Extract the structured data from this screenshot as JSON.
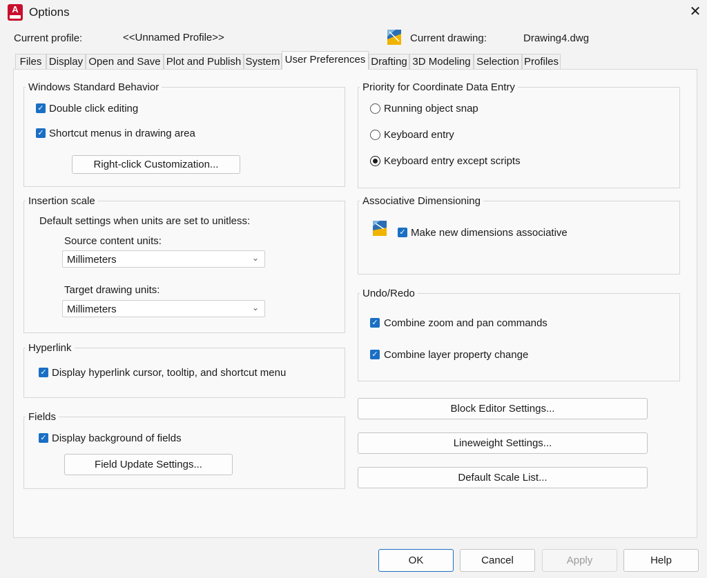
{
  "window": {
    "title": "Options",
    "app_icon_letter": "A",
    "close_icon": "close-icon"
  },
  "profile": {
    "label": "Current profile:",
    "value": "<<Unnamed Profile>>",
    "drawing_label": "Current drawing:",
    "drawing_value": "Drawing4.dwg",
    "drawing_icon": "drawing-icon"
  },
  "tabs": [
    {
      "label": "Files"
    },
    {
      "label": "Display"
    },
    {
      "label": "Open and Save"
    },
    {
      "label": "Plot and Publish"
    },
    {
      "label": "System"
    },
    {
      "label": "User Preferences",
      "active": true
    },
    {
      "label": "Drafting"
    },
    {
      "label": "3D Modeling"
    },
    {
      "label": "Selection"
    },
    {
      "label": "Profiles"
    }
  ],
  "windows_behavior": {
    "title": "Windows Standard Behavior",
    "double_click": {
      "label": "Double click editing",
      "checked": true
    },
    "shortcut_menus": {
      "label": "Shortcut menus in drawing area",
      "checked": true
    },
    "right_click_button": "Right-click Customization..."
  },
  "insertion_scale": {
    "title": "Insertion scale",
    "description": "Default settings when units are set to unitless:",
    "source_label": "Source content units:",
    "source_value": "Millimeters",
    "target_label": "Target drawing units:",
    "target_value": "Millimeters"
  },
  "hyperlink": {
    "title": "Hyperlink",
    "display": {
      "label": "Display hyperlink cursor, tooltip, and shortcut menu",
      "checked": true
    }
  },
  "fields": {
    "title": "Fields",
    "display_bg": {
      "label": "Display background of fields",
      "checked": true
    },
    "update_button": "Field Update Settings..."
  },
  "coordinate_priority": {
    "title": "Priority for Coordinate Data Entry",
    "options": [
      {
        "label": "Running object snap",
        "selected": false
      },
      {
        "label": "Keyboard entry",
        "selected": false
      },
      {
        "label": "Keyboard entry except scripts",
        "selected": true
      }
    ]
  },
  "associative": {
    "title": "Associative Dimensioning",
    "icon": "associative-dimension-icon",
    "make_new": {
      "label": "Make new dimensions associative",
      "checked": true
    }
  },
  "undo_redo": {
    "title": "Undo/Redo",
    "zoom_pan": {
      "label": "Combine zoom and pan commands",
      "checked": true
    },
    "layer_prop": {
      "label": "Combine layer property change",
      "checked": true
    }
  },
  "right_buttons": {
    "block_editor": "Block Editor Settings...",
    "lineweight": "Lineweight Settings...",
    "scale_list": "Default Scale List..."
  },
  "footer": {
    "ok": "OK",
    "cancel": "Cancel",
    "apply": "Apply",
    "help": "Help"
  },
  "check_glyph": "✓",
  "colors": {
    "accent": "#1a6fc4",
    "app_red": "#c8102e"
  }
}
